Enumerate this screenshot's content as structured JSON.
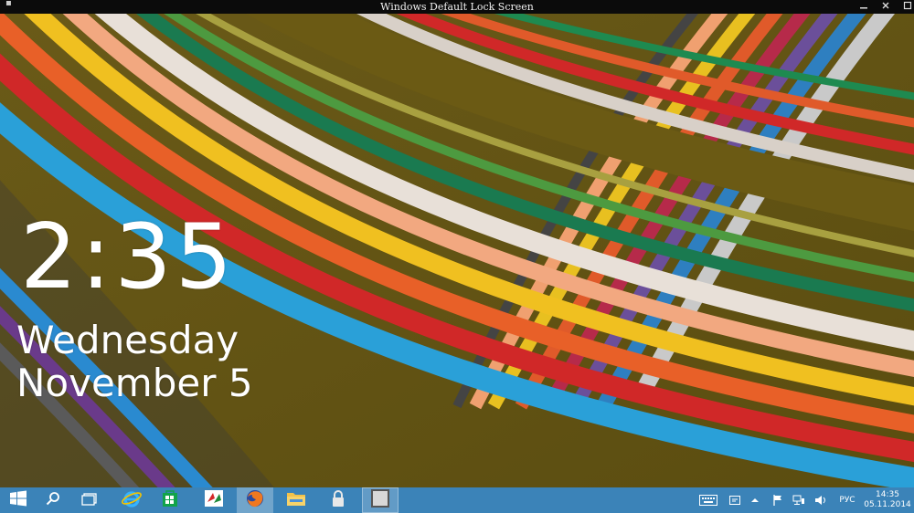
{
  "window": {
    "title": "Windows Default Lock Screen",
    "system_menu_icon": "system-menu-icon",
    "controls": {
      "minimize_icon": "minimize-icon",
      "close_icon": "close-icon",
      "maximize_icon": "maximize-icon"
    }
  },
  "lockscreen": {
    "time": "2:35",
    "weekday": "Wednesday",
    "date": "November 5"
  },
  "taskbar": {
    "color": "#3b83b8",
    "buttons": [
      {
        "name": "start-button",
        "icon": "windows-logo-icon"
      },
      {
        "name": "search-button",
        "icon": "search-icon"
      },
      {
        "name": "task-view-button",
        "icon": "task-view-icon"
      },
      {
        "name": "internet-explorer-button",
        "icon": "internet-explorer-icon"
      },
      {
        "name": "store-button",
        "icon": "store-icon"
      },
      {
        "name": "app-button",
        "icon": "app-icon"
      },
      {
        "name": "firefox-button",
        "icon": "firefox-icon"
      },
      {
        "name": "file-explorer-button",
        "icon": "folder-icon"
      },
      {
        "name": "lock-screen-app-button",
        "icon": "lock-icon"
      },
      {
        "name": "window-button",
        "icon": "window-icon"
      }
    ],
    "tray": {
      "keyboard_icon": "touch-keyboard-icon",
      "notification_icon": "message-icon",
      "show_hidden_icon": "chevron-up-icon",
      "flag_icon": "action-center-flag-icon",
      "network_icon": "network-icon",
      "volume_icon": "volume-icon",
      "language": "РУС",
      "clock_time": "14:35",
      "clock_date": "05.11.2014"
    }
  }
}
